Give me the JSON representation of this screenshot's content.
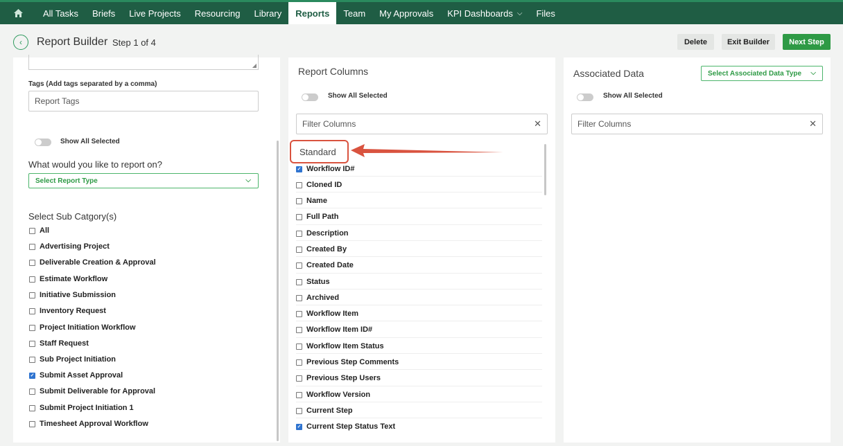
{
  "nav": {
    "items": [
      "All Tasks",
      "Briefs",
      "Live Projects",
      "Resourcing",
      "Library",
      "Reports",
      "Team",
      "My Approvals",
      "KPI Dashboards",
      "Files"
    ],
    "active": "Reports",
    "dropdown_item": "KPI Dashboards"
  },
  "header": {
    "title": "Report Builder",
    "step": "Step 1 of 4",
    "delete_label": "Delete",
    "exit_label": "Exit Builder",
    "next_label": "Next Step"
  },
  "left": {
    "tags_label": "Tags (Add tags separated by a comma)",
    "tags_placeholder": "Report Tags",
    "show_all_selected": "Show All Selected",
    "question": "What would you like to report on?",
    "report_type": "Select Report Type",
    "sub_category_label": "Select Sub Catgory(s)",
    "sub_categories": [
      {
        "label": "All",
        "checked": false
      },
      {
        "label": "Advertising Project",
        "checked": false
      },
      {
        "label": "Deliverable Creation & Approval",
        "checked": false
      },
      {
        "label": "Estimate Workflow",
        "checked": false
      },
      {
        "label": "Initiative Submission",
        "checked": false
      },
      {
        "label": "Inventory Request",
        "checked": false
      },
      {
        "label": "Project Initiation Workflow",
        "checked": false
      },
      {
        "label": "Staff Request",
        "checked": false
      },
      {
        "label": "Sub Project Initiation",
        "checked": false
      },
      {
        "label": "Submit Asset Approval",
        "checked": true
      },
      {
        "label": "Submit Deliverable for Approval",
        "checked": false
      },
      {
        "label": "Submit Project Initiation 1",
        "checked": false
      },
      {
        "label": "Timesheet Approval Workflow",
        "checked": false
      }
    ]
  },
  "middle": {
    "title": "Report Columns",
    "show_all_selected": "Show All Selected",
    "filter_placeholder": "Filter Columns",
    "section": "Standard",
    "columns": [
      {
        "label": "Workflow ID#",
        "checked": true
      },
      {
        "label": "Cloned ID",
        "checked": false
      },
      {
        "label": "Name",
        "checked": false
      },
      {
        "label": "Full Path",
        "checked": false
      },
      {
        "label": "Description",
        "checked": false
      },
      {
        "label": "Created By",
        "checked": false
      },
      {
        "label": "Created Date",
        "checked": false
      },
      {
        "label": "Status",
        "checked": false
      },
      {
        "label": "Archived",
        "checked": false
      },
      {
        "label": "Workflow Item",
        "checked": false
      },
      {
        "label": "Workflow Item ID#",
        "checked": false
      },
      {
        "label": "Workflow Item Status",
        "checked": false
      },
      {
        "label": "Previous Step Comments",
        "checked": false
      },
      {
        "label": "Previous Step Users",
        "checked": false
      },
      {
        "label": "Workflow Version",
        "checked": false
      },
      {
        "label": "Current Step",
        "checked": false
      },
      {
        "label": "Current Step Status Text",
        "checked": true
      }
    ]
  },
  "right": {
    "title": "Associated Data",
    "select_label": "Select Associated Data Type",
    "show_all_selected": "Show All Selected",
    "filter_placeholder": "Filter Columns"
  },
  "colors": {
    "nav_bg": "#1f5d44",
    "accent_green": "#2e9a45",
    "highlight_red": "#d9533f",
    "checkbox_blue": "#2f74d0"
  }
}
